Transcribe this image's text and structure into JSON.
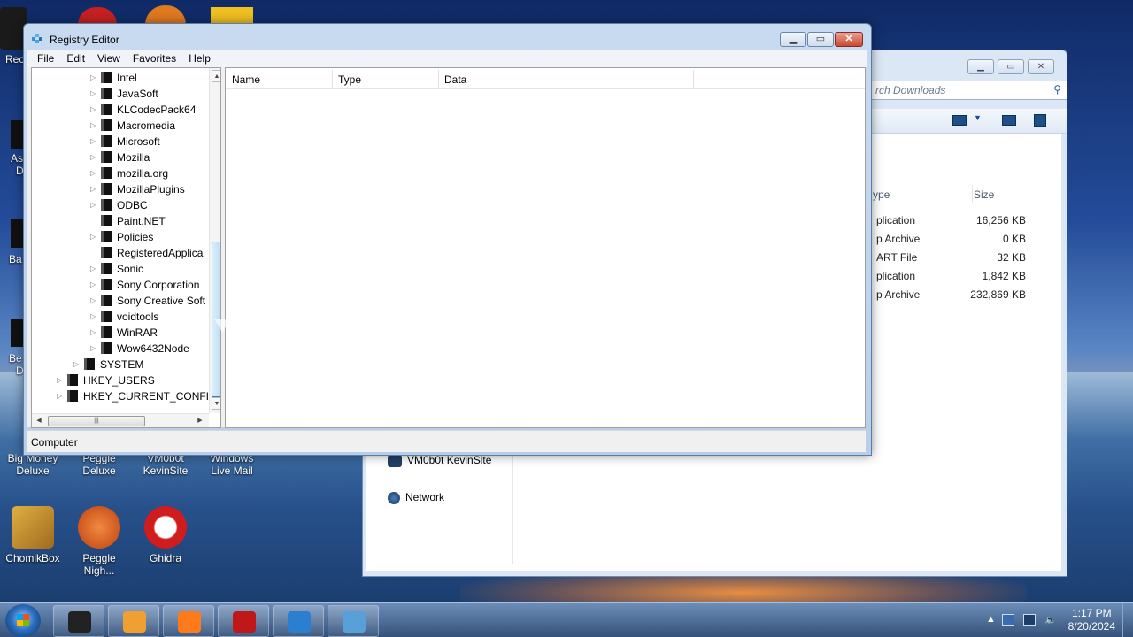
{
  "desktop": {
    "icons": [
      {
        "label": "Big Money\nDeluxe",
        "color": "#c79a2a"
      },
      {
        "label": "Peggle\nDeluxe",
        "color": "#d8622a"
      },
      {
        "label": "VM0b0t\nKevinSite",
        "color": "#6b86b0"
      },
      {
        "label": "Windows\nLive Mail",
        "color": "#f0c020"
      },
      {
        "label": "ChomikBox",
        "color": "#d4a030"
      },
      {
        "label": "Peggle\nNigh...",
        "color": "#e06a30"
      },
      {
        "label": "Ghidra",
        "color": "#d02020"
      }
    ],
    "partial_labels": [
      "Rec",
      "As",
      "D",
      "Ba",
      "Be",
      "D"
    ]
  },
  "explorer": {
    "search_placeholder": "rch Downloads",
    "columns": {
      "type": "ype",
      "size": "Size"
    },
    "rows": [
      {
        "type": "plication",
        "size": "16,256 KB"
      },
      {
        "type": "p Archive",
        "size": "0 KB"
      },
      {
        "type": "ART File",
        "size": "32 KB"
      },
      {
        "type": "plication",
        "size": "1,842 KB"
      },
      {
        "type": "p Archive",
        "size": "232,869 KB"
      }
    ],
    "nav": {
      "vm": "VM0b0t KevinSite",
      "network": "Network"
    }
  },
  "regedit": {
    "title": "Registry Editor",
    "menu": [
      "File",
      "Edit",
      "View",
      "Favorites",
      "Help"
    ],
    "tree": [
      {
        "label": "Intel",
        "expandable": true
      },
      {
        "label": "JavaSoft",
        "expandable": true
      },
      {
        "label": "KLCodecPack64",
        "expandable": true
      },
      {
        "label": "Macromedia",
        "expandable": true
      },
      {
        "label": "Microsoft",
        "expandable": true
      },
      {
        "label": "Mozilla",
        "expandable": true
      },
      {
        "label": "mozilla.org",
        "expandable": true
      },
      {
        "label": "MozillaPlugins",
        "expandable": true
      },
      {
        "label": "ODBC",
        "expandable": true
      },
      {
        "label": "Paint.NET",
        "expandable": false
      },
      {
        "label": "Policies",
        "expandable": true
      },
      {
        "label": "RegisteredApplica",
        "expandable": false
      },
      {
        "label": "Sonic",
        "expandable": true
      },
      {
        "label": "Sony Corporation",
        "expandable": true
      },
      {
        "label": "Sony Creative Soft",
        "expandable": true
      },
      {
        "label": "voidtools",
        "expandable": true
      },
      {
        "label": "WinRAR",
        "expandable": true
      },
      {
        "label": "Wow6432Node",
        "expandable": true
      }
    ],
    "tree_roots": [
      {
        "label": "SYSTEM",
        "level": 1
      },
      {
        "label": "HKEY_USERS",
        "level": 0
      },
      {
        "label": "HKEY_CURRENT_CONFIG",
        "level": 0
      }
    ],
    "columns": {
      "name": "Name",
      "type": "Type",
      "data": "Data"
    },
    "status": "Computer"
  },
  "taskbar": {
    "buttons": [
      {
        "name": "cmd",
        "color": "#222222"
      },
      {
        "name": "media-center",
        "color": "#f0a030"
      },
      {
        "name": "firefox",
        "color": "#ff7a1a"
      },
      {
        "name": "record",
        "color": "#c01818"
      },
      {
        "name": "media-player",
        "color": "#2a7fd0"
      },
      {
        "name": "regedit",
        "color": "#5aa0d8"
      }
    ],
    "time": "1:17 PM",
    "date": "8/20/2024"
  }
}
